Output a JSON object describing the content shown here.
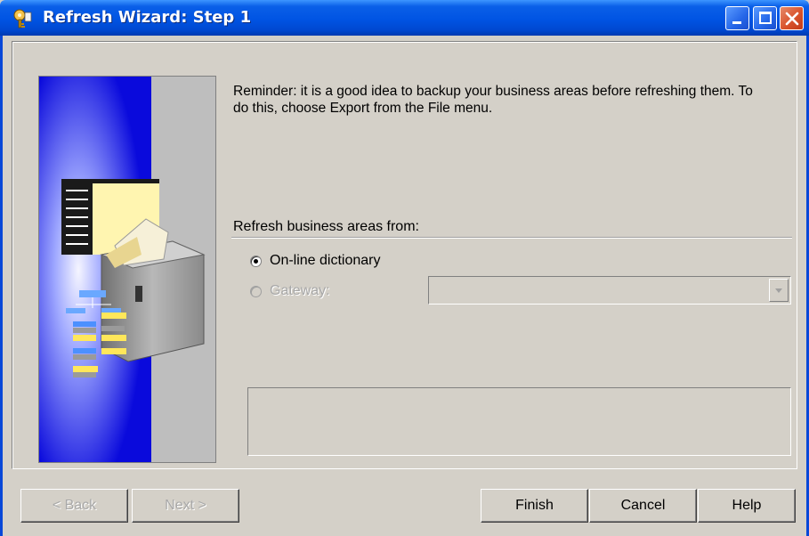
{
  "window": {
    "title": "Refresh Wizard: Step 1",
    "title_bar_color": "#0054e3",
    "close_button_color": "#d9532c"
  },
  "main": {
    "reminder_text": "Reminder: it is a good idea to backup your business areas before refreshing them. To do this, choose Export from the File menu.",
    "section_label": "Refresh business areas from:",
    "options": [
      {
        "label": "On-line dictionary",
        "selected": true,
        "enabled": true
      },
      {
        "label": "Gateway:",
        "selected": false,
        "enabled": false
      }
    ],
    "gateway_select": {
      "value": "",
      "enabled": false
    },
    "message": ""
  },
  "buttons": {
    "back": "< Back",
    "next": "Next >",
    "finish": "Finish",
    "cancel": "Cancel",
    "help": "Help"
  },
  "icons": {
    "app": "wizard-key-icon",
    "minimize": "minimize-icon",
    "maximize": "maximize-icon",
    "close": "close-icon",
    "illustration": "file-cabinet-illustration"
  }
}
